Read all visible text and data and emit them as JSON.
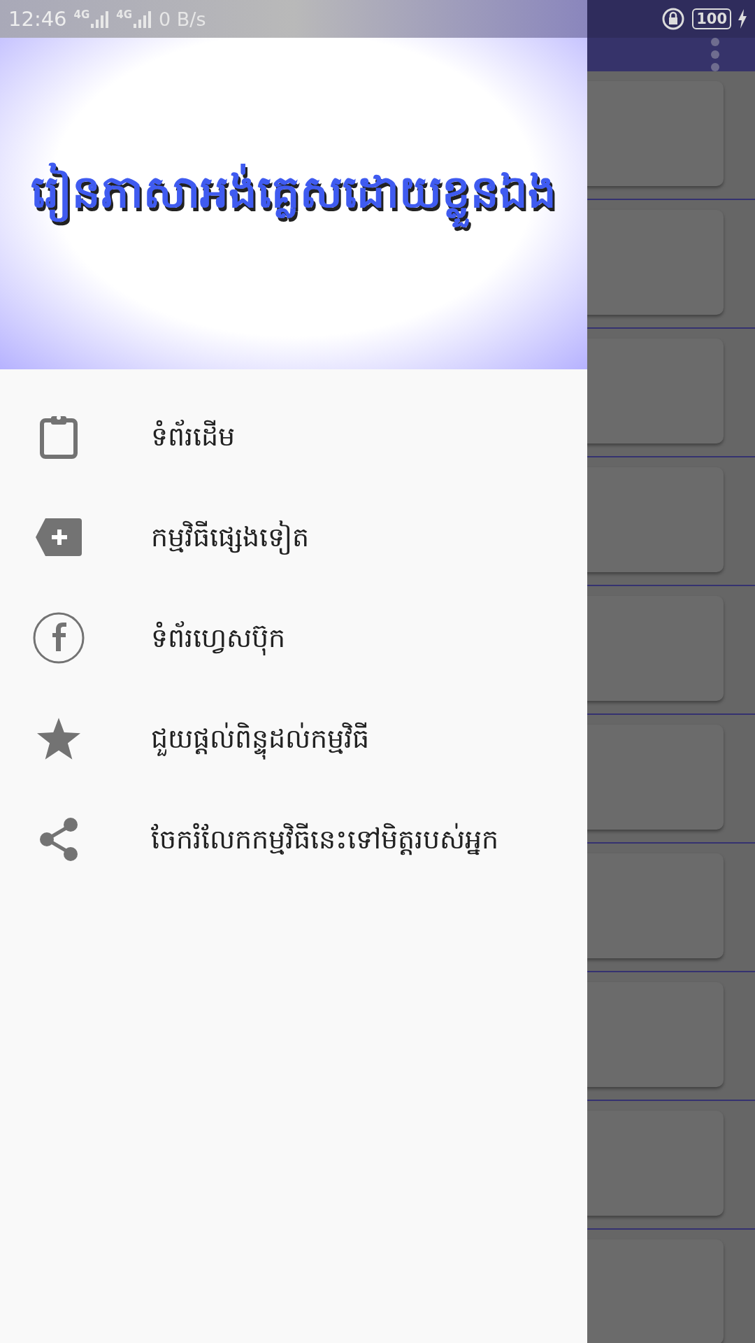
{
  "status_bar": {
    "time": "12:46",
    "network_1": "4G",
    "network_2": "4G",
    "speed": "0 B/s",
    "battery": "100"
  },
  "drawer": {
    "header_title": "រៀនភាសាអង់គ្លេសដោយខ្លួនឯង",
    "items": [
      {
        "label": "ទំព័រដើម"
      },
      {
        "label": "កម្មវិធីផ្សេងទៀត"
      },
      {
        "label": "ទំព័រហ្វេសប៊ុក"
      },
      {
        "label": "ជួយផ្តល់ពិន្ទុដល់កម្មវិធី"
      },
      {
        "label": "ចែករំលែកកម្មវិធីនេះទៅមិត្តរបស់អ្នក"
      }
    ]
  }
}
